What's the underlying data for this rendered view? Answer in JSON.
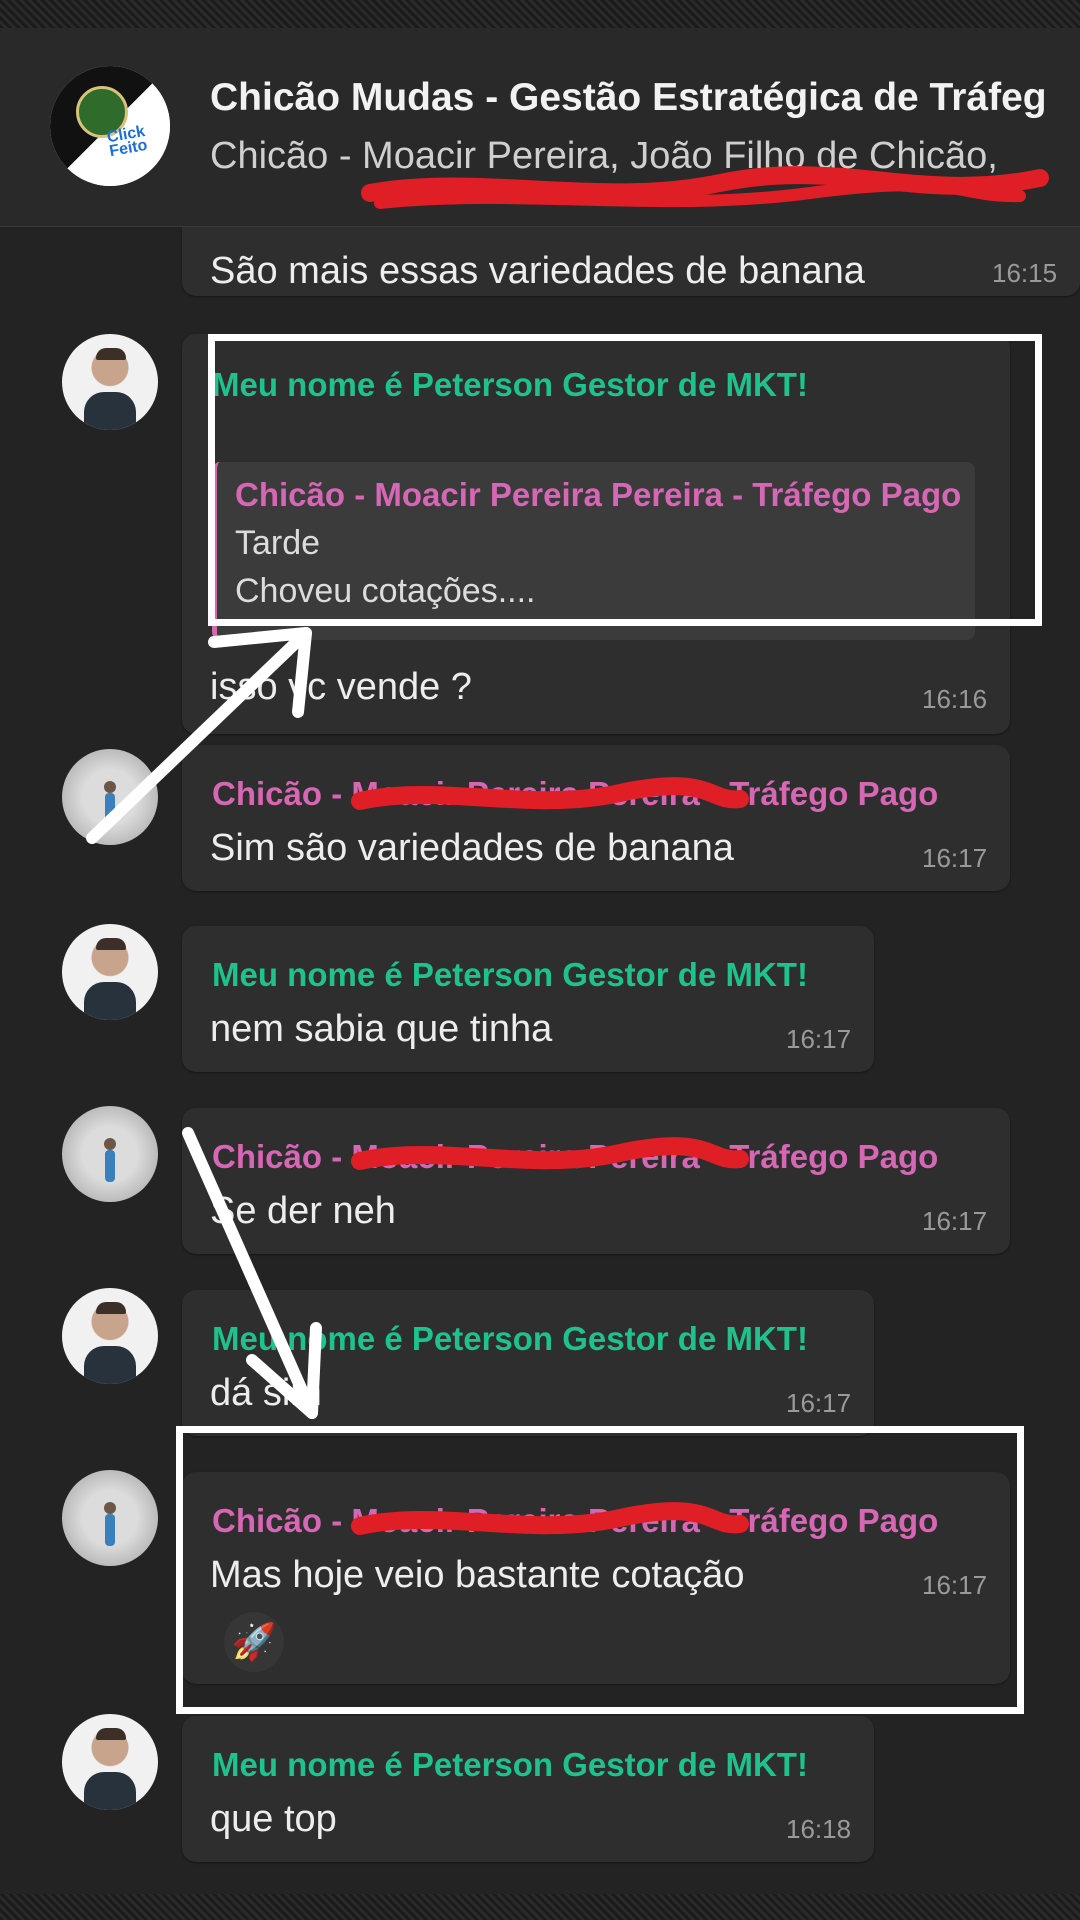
{
  "header": {
    "group_name": "Chicão Mudas - Gestão Estratégica de Tráfeg",
    "members": "Chicão - Moacir Pereira, João Filho de Chicão,",
    "avatar_text": "Click Feito"
  },
  "messages": [
    {
      "text": "São mais essas variedades de banana",
      "time": "16:15"
    },
    {
      "sender": "Meu nome é Peterson Gestor de MKT!",
      "quote": {
        "author": "Chicão - Moacir Pereira Pereira - Tráfego Pago",
        "line1": "Tarde",
        "line2": "Choveu cotações...."
      },
      "text": "isso vc vende ?",
      "time": "16:16"
    },
    {
      "sender": "Chicão - Moacir Pereira Pereira - Tráfego Pago",
      "text": "Sim são variedades de banana",
      "time": "16:17"
    },
    {
      "sender": "Meu nome é Peterson Gestor de MKT!",
      "text": "nem sabia que tinha",
      "time": "16:17"
    },
    {
      "sender": "Chicão - Moacir Pereira Pereira - Tráfego Pago",
      "text": "Se der neh",
      "time": "16:17"
    },
    {
      "sender": "Meu nome é Peterson Gestor de MKT!",
      "text": "dá sim",
      "time": "16:17"
    },
    {
      "sender": "Chicão - Moacir Pereira Pereira - Tráfego Pago",
      "text": "Mas hoje veio bastante cotação",
      "time": "16:17",
      "reaction": "🚀"
    },
    {
      "sender": "Meu nome é Peterson Gestor de MKT!",
      "text": "que top",
      "time": "16:18"
    }
  ],
  "colors": {
    "peterson_name": "#1fc18d",
    "chicao_name": "#d667b5",
    "bubble": "#2e2e2e",
    "background": "#232323",
    "annotation": "#ffffff",
    "redaction": "#e01e26"
  }
}
